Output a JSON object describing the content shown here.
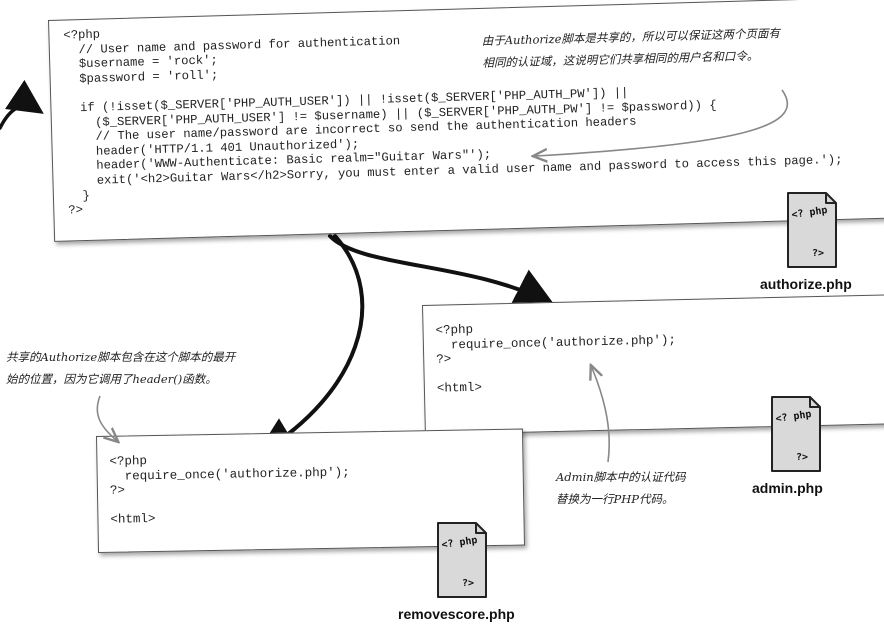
{
  "authorize_panel": {
    "code_lines": [
      "<?php",
      "  // User name and password for authentication",
      "  $username = 'rock';",
      "  $password = 'roll';",
      "",
      "  if (!isset($_SERVER['PHP_AUTH_USER']) || !isset($_SERVER['PHP_AUTH_PW']) ||",
      "    ($_SERVER['PHP_AUTH_USER'] != $username) || ($_SERVER['PHP_AUTH_PW'] != $password)) {",
      "    // The user name/password are incorrect so send the authentication headers",
      "    header('HTTP/1.1 401 Unauthorized');",
      "    header('WWW-Authenticate: Basic realm=\"Guitar Wars\"');",
      "    exit('<h2>Guitar Wars</h2>Sorry, you must enter a valid user name and password to access this page.');",
      "  }",
      "?>"
    ]
  },
  "admin_panel": {
    "code_lines": [
      "<?php",
      "  require_once('authorize.php');",
      "?>",
      "",
      "<html>"
    ]
  },
  "removescore_panel": {
    "code_lines": [
      "<?php",
      "  require_once('authorize.php');",
      "?>",
      "",
      "<html>"
    ]
  },
  "files": {
    "authorize": "authorize.php",
    "admin": "admin.php",
    "removescore": "removescore.php",
    "icon_text_top": "<? php",
    "icon_text_bottom": "?>"
  },
  "annotations": {
    "shared_realm": [
      "由于Authorize脚本是共享的，所以可以保证这两个页面有",
      "相同的认证域，这说明它们共享相同的用户名和口令。"
    ],
    "top_of_script": [
      "共享的Authorize脚本包含在这个脚本的最开",
      "始的位置，因为它调用了header()函数。"
    ],
    "admin_replaced": [
      "Admin脚本中的认证代码",
      "替换为一行PHP代码。"
    ]
  }
}
